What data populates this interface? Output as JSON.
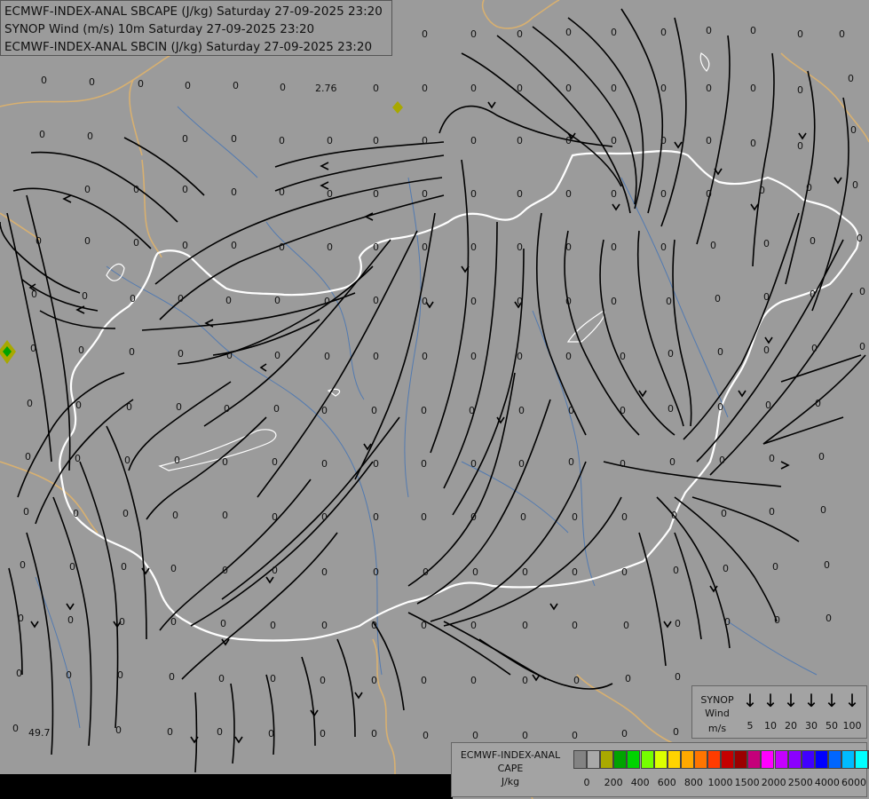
{
  "titles": {
    "line1": "ECMWF-INDEX-ANAL SBCAPE (J/kg) Saturday 27-09-2025 23:20",
    "line2": "SYNOP Wind (m/s) 10m Saturday 27-09-2025 23:20",
    "line3": "ECMWF-INDEX-ANAL SBCIN (J/kg) Saturday 27-09-2025 23:20"
  },
  "map_values": {
    "zero": "0",
    "cape_high_1": "2.76",
    "cape_high_2": "49.7"
  },
  "wind_legend": {
    "label1": "SYNOP",
    "label2": "Wind",
    "label3": "m/s",
    "arrow_icon": "↓",
    "values": [
      "5",
      "10",
      "20",
      "30",
      "50",
      "100"
    ]
  },
  "cape_legend": {
    "label1": "ECMWF-INDEX-ANAL",
    "label2": "CAPE",
    "label3": "J/kg",
    "colors": [
      "#838383",
      "#a9a9a9",
      "#a9a900",
      "#00a300",
      "#00d300",
      "#75ff00",
      "#dcff00",
      "#ffd300",
      "#ffa900",
      "#ff7500",
      "#ff3c00",
      "#c50000",
      "#9b0000",
      "#c5007a",
      "#ff00ff",
      "#c500ff",
      "#8b00ff",
      "#4000ff",
      "#0000ff",
      "#0066ff",
      "#00bbff",
      "#00ffff",
      "#ffffff"
    ],
    "ticks": [
      "0",
      "200",
      "400",
      "600",
      "800",
      "1000",
      "1500",
      "2000",
      "2500",
      "4000",
      "6000"
    ]
  },
  "colors": {
    "background": "#9b9b9b",
    "streamline": "#000000",
    "border": "#ffffff",
    "region_border": "#d8b070",
    "river": "#3a6fb8",
    "cape_marker": "#a8a800"
  }
}
